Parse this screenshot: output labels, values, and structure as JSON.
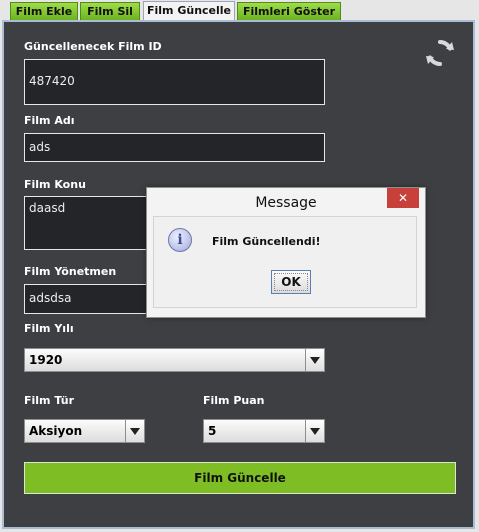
{
  "tabs": [
    {
      "label": "Film Ekle"
    },
    {
      "label": "Film Sil"
    },
    {
      "label": "Film Güncelle",
      "active": true
    },
    {
      "label": "Filmleri Göster"
    }
  ],
  "form": {
    "film_id_label": "Güncellenecek Film ID",
    "film_id_value": "487420",
    "film_adi_label": "Film Adı",
    "film_adi_value": "ads",
    "film_konu_label": "Film Konu",
    "film_konu_value": "daasd",
    "film_yonetmen_label": "Film Yönetmen",
    "film_yonetmen_value": "adsdsa",
    "film_yili_label": "Film Yılı",
    "film_yili_value": "1920",
    "film_tur_label": "Film Tür",
    "film_tur_value": "Aksiyon",
    "film_puan_label": "Film Puan",
    "film_puan_value": "5",
    "submit_label": "Film Güncelle"
  },
  "dialog": {
    "title": "Message",
    "close_glyph": "✕",
    "icon_glyph": "i",
    "message": "Film Güncellendi!",
    "ok_label": "OK"
  },
  "icons": {
    "refresh": "refresh-icon",
    "info": "info-icon",
    "close": "close-icon"
  },
  "colors": {
    "tab_green": "#7ebd24",
    "panel_bg": "#3d3f42",
    "field_bg": "#232528",
    "close_red": "#c7403a"
  }
}
